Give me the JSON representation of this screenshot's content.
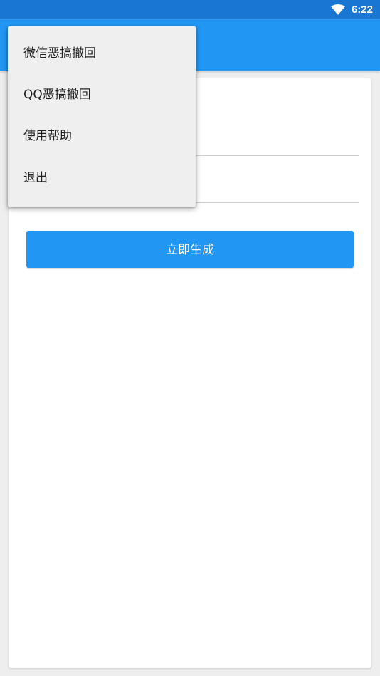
{
  "status_bar": {
    "time": "6:22",
    "wifi_icon": "wifi-icon"
  },
  "overflow_menu": {
    "items": [
      {
        "label": "微信恶搞撤回"
      },
      {
        "label": "QQ恶搞撤回"
      },
      {
        "label": "使用帮助"
      },
      {
        "label": "退出"
      }
    ]
  },
  "form": {
    "generate_button_label": "立即生成"
  },
  "colors": {
    "status_bar": "#1976d2",
    "app_bar": "#2196f3",
    "button": "#2196f3",
    "background": "#eeeeee",
    "menu": "#efefef"
  }
}
